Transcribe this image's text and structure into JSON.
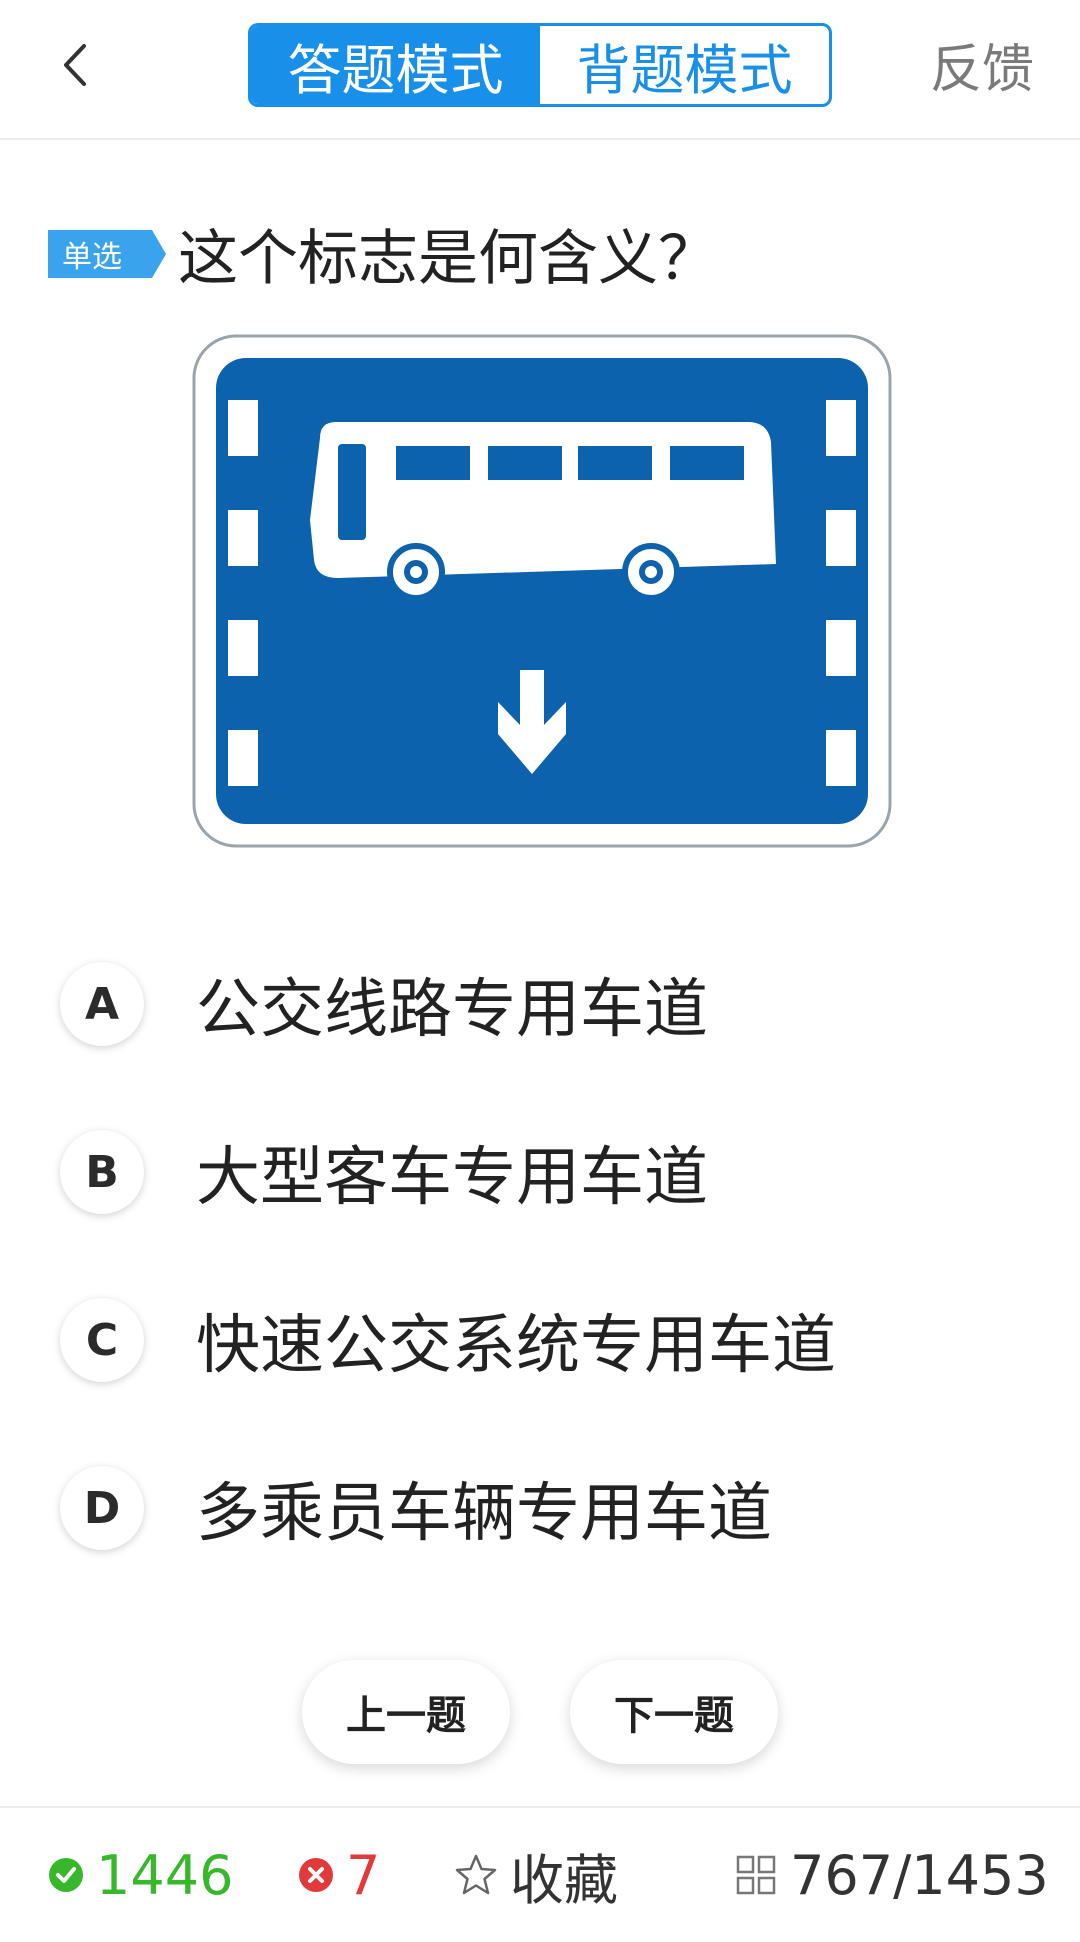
{
  "header": {
    "modes": [
      "答题模式",
      "背题模式"
    ],
    "active_mode": "答题模式",
    "feedback_label": "反馈"
  },
  "question": {
    "type_badge": "单选",
    "text": "这个标志是何含义？"
  },
  "options": [
    {
      "letter": "A",
      "text": "公交线路专用车道"
    },
    {
      "letter": "B",
      "text": "大型客车专用车道"
    },
    {
      "letter": "C",
      "text": "快速公交系统专用车道"
    },
    {
      "letter": "D",
      "text": "多乘员车辆专用车道"
    }
  ],
  "nav": {
    "prev_label": "上一题",
    "next_label": "下一题"
  },
  "footer": {
    "correct_count": "1446",
    "wrong_count": "7",
    "favorite_label": "收藏",
    "progress": "767/1453"
  },
  "colors": {
    "accent": "#1890ea",
    "sign_blue": "#0d62ad",
    "correct": "#37b82b",
    "wrong": "#e23a3a"
  }
}
